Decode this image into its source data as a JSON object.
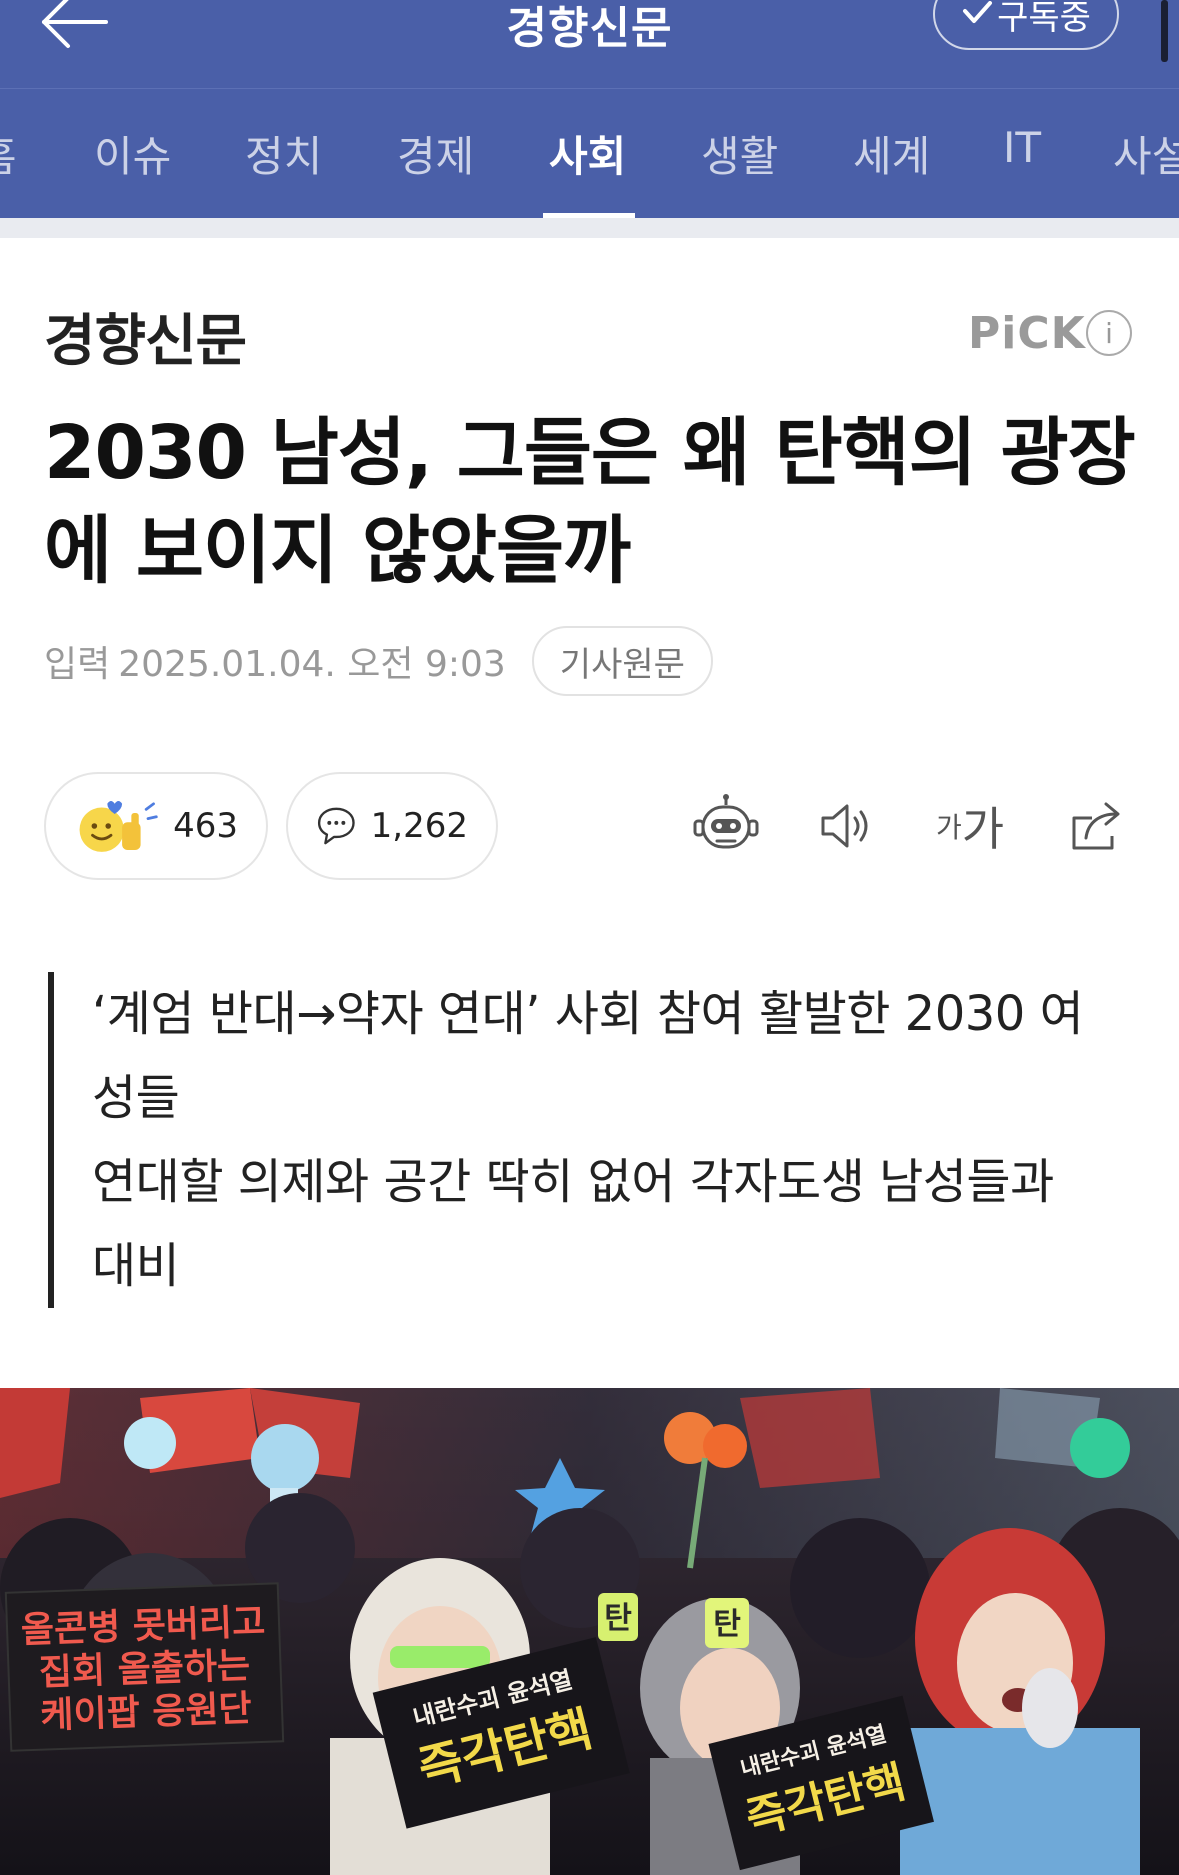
{
  "header": {
    "press_name": "경향신문",
    "subscribe_label": "구독중"
  },
  "tabs": [
    {
      "label": "홈"
    },
    {
      "label": "이슈"
    },
    {
      "label": "정치"
    },
    {
      "label": "경제"
    },
    {
      "label": "사회",
      "active": true
    },
    {
      "label": "생활"
    },
    {
      "label": "세계"
    },
    {
      "label": "IT"
    },
    {
      "label": "사설"
    }
  ],
  "article": {
    "press_logo": "경향신문",
    "pick_label": "PiCK",
    "info_label": "i",
    "headline_line1": "2030 남성, 그들은 왜 탄핵의 광장",
    "headline_line2": "에 보이지 않았을까",
    "date_label": "입력",
    "date_value": "2025.01.04. 오전 9:03",
    "origin_label": "기사원문",
    "reaction_count": "463",
    "comment_count": "1,262",
    "font_small": "가",
    "font_large": "가",
    "summary_lines": [
      "‘계엄 반대→약자 연대’ 사회 참여 활발한 2030 여",
      "성들",
      "연대할 의제와 공간 딱히 없어 각자도생 남성들과",
      "대비"
    ]
  },
  "photo": {
    "sign_left_top": "올콘병 못버리고",
    "sign_left_mid": "집회 올출하는",
    "sign_left_bot": "케이팝 응원단",
    "sign_center_top": "내란수괴 윤석열",
    "sign_center_bot": "즉각탄핵",
    "sign_right_top": "내란수괴 윤석열",
    "sign_right_bot": "즉각탄핵",
    "stick_label": "탄"
  },
  "colors": {
    "header_bg": "#4a5fa8",
    "sign_red": "#e0463a",
    "sign_yellow": "#f2d94a"
  }
}
